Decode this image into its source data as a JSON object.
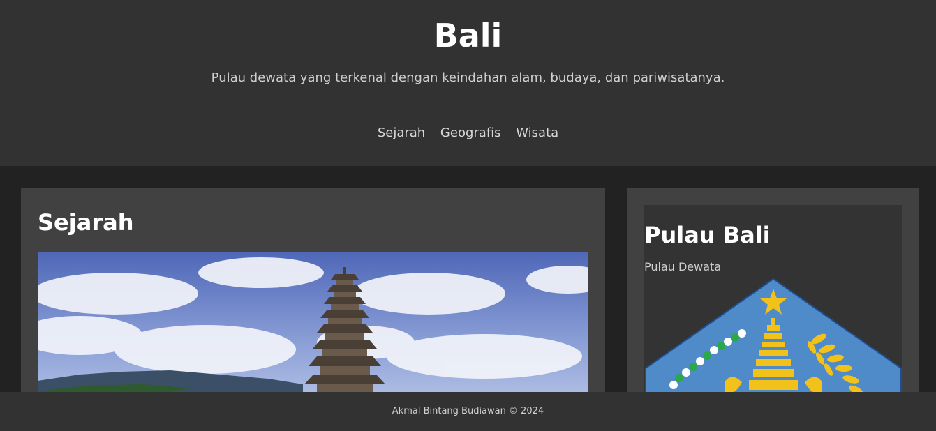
{
  "header": {
    "title": "Bali",
    "tagline": "Pulau dewata yang terkenal dengan keindahan alam, budaya, dan pariwisatanya."
  },
  "nav": {
    "items": [
      "Sejarah",
      "Geografis",
      "Wisata"
    ]
  },
  "main": {
    "section_title": "Sejarah",
    "image": "photo-pura-ulun-danu-bratan-pagoda"
  },
  "sidebar": {
    "title": "Pulau Bali",
    "subtitle": "Pulau Dewata",
    "image": "bali-province-coat-of-arms"
  },
  "footer": {
    "text": "Akmal Bintang Budiawan © 2024"
  },
  "colors": {
    "page_bg": "#222222",
    "header_bg": "#323232",
    "card_bg": "#414141",
    "emblem_blue": "#4f8bc9",
    "emblem_gold": "#f2c21b"
  }
}
